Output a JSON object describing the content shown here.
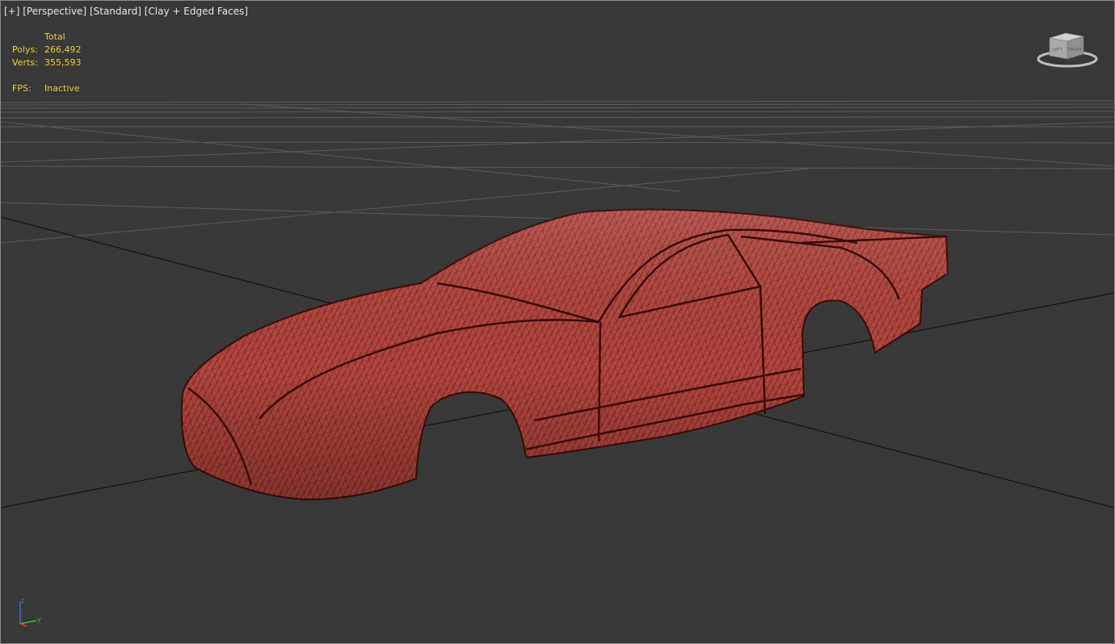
{
  "viewport": {
    "label_parts": [
      "[+]",
      "[Perspective]",
      "[Standard]",
      "[Clay + Edged Faces]"
    ]
  },
  "stats": {
    "total_label": "Total",
    "polys_label": "Polys:",
    "polys_value": "266,492",
    "verts_label": "Verts:",
    "verts_value": "355,593",
    "fps_label": "FPS:",
    "fps_value": "Inactive"
  },
  "viewcube": {
    "icon": "viewcube-icon",
    "face_left": "LEFT",
    "face_right": "RIGHT"
  },
  "axes": {
    "z_label": "z",
    "y_label": "y"
  },
  "colors": {
    "viewport_bg": "#383838",
    "stats_text": "#e8d03a",
    "label_text": "#e6e6e6",
    "model_clay": "#b2473f",
    "model_edges": "#5a1510",
    "grid_line": "#5a5a5a",
    "grid_axis": "#141414"
  }
}
